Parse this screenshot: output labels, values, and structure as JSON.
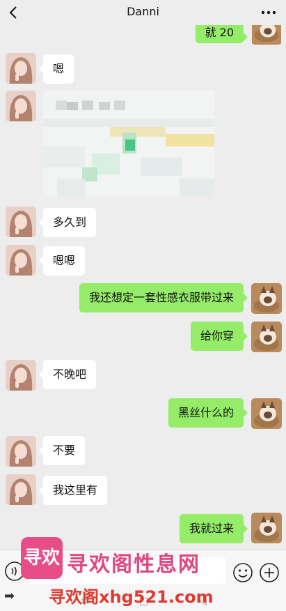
{
  "header": {
    "title": "Danni"
  },
  "messages": [
    {
      "from": "me",
      "text": "就 20"
    },
    {
      "from": "other",
      "text": "嗯"
    },
    {
      "from": "other",
      "type": "image"
    },
    {
      "from": "other",
      "text": "多久到"
    },
    {
      "from": "other",
      "text": "嗯嗯"
    },
    {
      "from": "me",
      "text": "我还想定一套性感衣服带过来"
    },
    {
      "from": "me",
      "text": "给你穿"
    },
    {
      "from": "other",
      "text": "不晚吧"
    },
    {
      "from": "me",
      "text": "黑丝什么的"
    },
    {
      "from": "other",
      "text": "不要"
    },
    {
      "from": "other",
      "text": "我这里有"
    },
    {
      "from": "me",
      "text": "我就过来"
    }
  ],
  "watermark": {
    "logo_text": "寻欢",
    "title": "寻欢阁性息网",
    "url": "寻欢阁xhg521.com"
  },
  "icons": {
    "back": "chevron-left-icon",
    "more": "more-dots-icon",
    "voice": "voice-icon",
    "emoji": "emoji-icon",
    "plus": "plus-icon"
  },
  "colors": {
    "background": "#ededed",
    "outgoing_bubble": "#95ec69",
    "incoming_bubble": "#ffffff",
    "watermark_pink": "#e0467f",
    "watermark_red": "#e03a30"
  }
}
